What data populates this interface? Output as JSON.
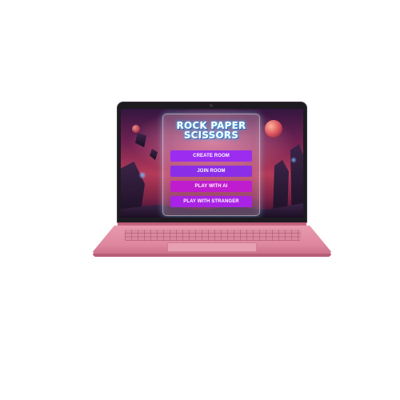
{
  "app": {
    "title": "ROCK PAPER SCISSORS"
  },
  "menu": {
    "buttons": [
      {
        "label": "CREATE ROOM",
        "color": "#9b2cf0"
      },
      {
        "label": "JOIN ROOM",
        "color": "#8a2ee8"
      },
      {
        "label": "PLAY WITH AI",
        "color": "#c01ccf"
      },
      {
        "label": "PLAY WITH STRANGER",
        "color": "#a823e6"
      }
    ]
  },
  "theme": {
    "laptop_color": "#e28fa5",
    "title_glow": "#4fc9ff"
  }
}
